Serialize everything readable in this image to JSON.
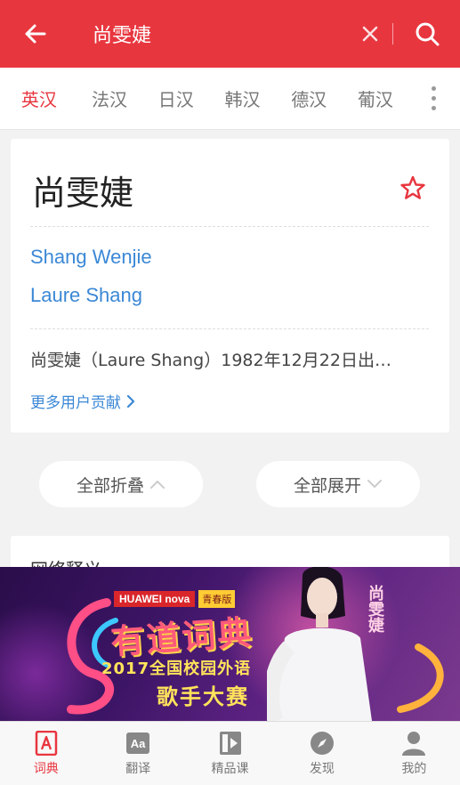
{
  "search": {
    "query": "尚雯婕"
  },
  "tabs": [
    {
      "label": "英汉",
      "active": true
    },
    {
      "label": "法汉",
      "active": false
    },
    {
      "label": "日汉",
      "active": false
    },
    {
      "label": "韩汉",
      "active": false
    },
    {
      "label": "德汉",
      "active": false
    },
    {
      "label": "葡汉",
      "active": false
    }
  ],
  "entry": {
    "word": "尚雯婕",
    "translations": [
      "Shang Wenjie",
      "Laure Shang"
    ],
    "description": "尚雯婕（Laure Shang）1982年12月22日出…",
    "more_contrib": "更多用户贡献"
  },
  "actions": {
    "collapse_all": "全部折叠",
    "expand_all": "全部展开"
  },
  "section2": {
    "title": "网络释义"
  },
  "ad": {
    "brand": "HUAWEI nova",
    "brand_tag": "青春版",
    "title": "有道词典",
    "line1": "2017全国校园外语",
    "line2": "歌手大赛",
    "side_name": "尚雯婕"
  },
  "bottom_nav": [
    {
      "label": "词典",
      "icon": "dictionary-icon",
      "active": true
    },
    {
      "label": "翻译",
      "icon": "translate-icon",
      "active": false
    },
    {
      "label": "精品课",
      "icon": "course-icon",
      "active": false
    },
    {
      "label": "发现",
      "icon": "compass-icon",
      "active": false
    },
    {
      "label": "我的",
      "icon": "profile-icon",
      "active": false
    }
  ],
  "colors": {
    "accent": "#e8363f",
    "link": "#3b88d6",
    "background": "#f2f2f2"
  }
}
